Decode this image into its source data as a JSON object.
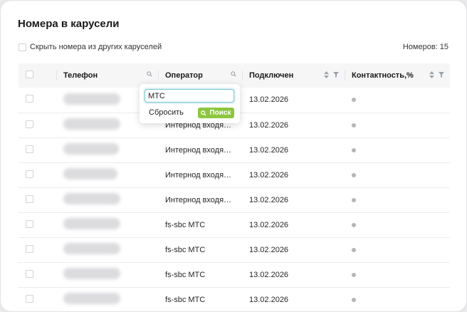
{
  "title": "Номера в карусели",
  "hide_filter": {
    "label": "Скрыть номера из других каруселей",
    "checked": false
  },
  "count": {
    "label": "Номеров:",
    "value": "15"
  },
  "columns": [
    {
      "label": "Телефон",
      "icon": "search-icon"
    },
    {
      "label": "Оператор",
      "icon": "search-icon"
    },
    {
      "label": "Подключен",
      "icons": [
        "sort-icon",
        "filter-icon"
      ]
    },
    {
      "label": "Контактность,%",
      "icons": [
        "sort-icon",
        "filter-icon"
      ]
    }
  ],
  "rows": [
    {
      "operator": "",
      "connected": "13.02.2026"
    },
    {
      "operator": "Интернод входящие …",
      "connected": "13.02.2026"
    },
    {
      "operator": "Интернод входящие …",
      "connected": "13.02.2026"
    },
    {
      "operator": "Интернод входящие …",
      "connected": "13.02.2026"
    },
    {
      "operator": "Интернод входящие …",
      "connected": "13.02.2026"
    },
    {
      "operator": "fs-sbc МТС",
      "connected": "13.02.2026"
    },
    {
      "operator": "fs-sbc МТС",
      "connected": "13.02.2026"
    },
    {
      "operator": "fs-sbc МТС",
      "connected": "13.02.2026"
    },
    {
      "operator": "fs-sbc МТС",
      "connected": "13.02.2026"
    }
  ],
  "operator_filter": {
    "value": "МТС",
    "reset_label": "Сбросить",
    "search_label": "Поиск",
    "accent_color": "#8cc63f",
    "focus_color": "#7cc6d2"
  },
  "status_dot_color": "#b5b5b8"
}
